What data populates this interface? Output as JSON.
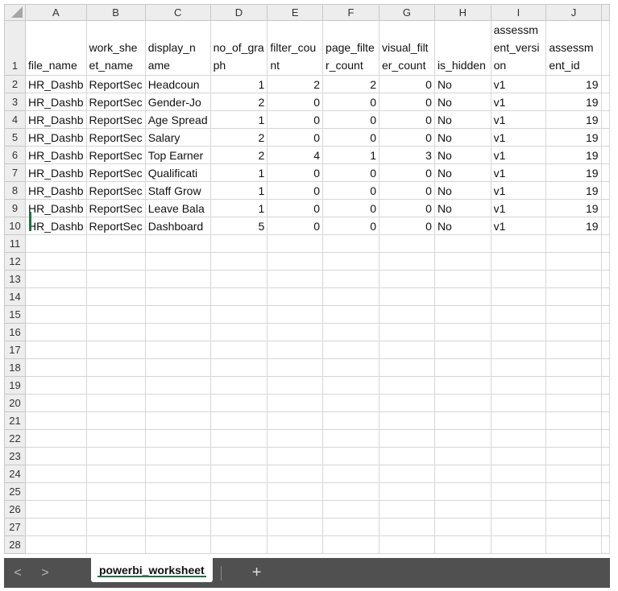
{
  "columns": [
    "A",
    "B",
    "C",
    "D",
    "E",
    "F",
    "G",
    "H",
    "I",
    "J"
  ],
  "header_row": {
    "row_number": "1",
    "cells": [
      "file_name",
      "work_she et_name",
      "display_n ame",
      "no_of_gra ph",
      "filter_cou nt",
      "page_filte r_count",
      "visual_filt er_count",
      "is_hidden",
      "assessm ent_versi on",
      "assessm ent_id"
    ]
  },
  "data_rows": [
    {
      "row": "2",
      "cells": [
        "HR_Dashb",
        "ReportSec",
        "Headcoun",
        "1",
        "2",
        "2",
        "0",
        "No",
        "v1",
        "19"
      ]
    },
    {
      "row": "3",
      "cells": [
        "HR_Dashb",
        "ReportSec",
        "Gender-Jo",
        "2",
        "0",
        "0",
        "0",
        "No",
        "v1",
        "19"
      ]
    },
    {
      "row": "4",
      "cells": [
        "HR_Dashb",
        "ReportSec",
        "Age Spread",
        "1",
        "0",
        "0",
        "0",
        "No",
        "v1",
        "19"
      ]
    },
    {
      "row": "5",
      "cells": [
        "HR_Dashb",
        "ReportSec",
        "Salary",
        "2",
        "0",
        "0",
        "0",
        "No",
        "v1",
        "19"
      ]
    },
    {
      "row": "6",
      "cells": [
        "HR_Dashb",
        "ReportSec",
        "Top Earner",
        "2",
        "4",
        "1",
        "3",
        "No",
        "v1",
        "19"
      ]
    },
    {
      "row": "7",
      "cells": [
        "HR_Dashb",
        "ReportSec",
        "Qualificati",
        "1",
        "0",
        "0",
        "0",
        "No",
        "v1",
        "19"
      ]
    },
    {
      "row": "8",
      "cells": [
        "HR_Dashb",
        "ReportSec",
        "Staff Grow",
        "1",
        "0",
        "0",
        "0",
        "No",
        "v1",
        "19"
      ]
    },
    {
      "row": "9",
      "cells": [
        "HR_Dashb",
        "ReportSec",
        "Leave Bala",
        "1",
        "0",
        "0",
        "0",
        "No",
        "v1",
        "19"
      ]
    },
    {
      "row": "10",
      "cells": [
        "HR_Dashb",
        "ReportSec",
        "Dashboard",
        "5",
        "0",
        "0",
        "0",
        "No",
        "v1",
        "19"
      ]
    }
  ],
  "empty_rows": [
    "11",
    "12",
    "13",
    "14",
    "15",
    "16",
    "17",
    "18",
    "19",
    "20",
    "21",
    "22",
    "23",
    "24",
    "25",
    "26",
    "27",
    "28"
  ],
  "numeric_columns": [
    3,
    4,
    5,
    6,
    9
  ],
  "tabs": {
    "prev_label": "<",
    "next_label": ">",
    "active_sheet": "powerbi_worksheet",
    "add_label": "+"
  },
  "colors": {
    "header_bg": "#ededed",
    "accent_green": "#1e7145",
    "tabbar_bg": "#505050"
  },
  "icons": [
    "select-all-corner-icon",
    "chevron-left-icon",
    "chevron-right-icon",
    "plus-icon"
  ]
}
